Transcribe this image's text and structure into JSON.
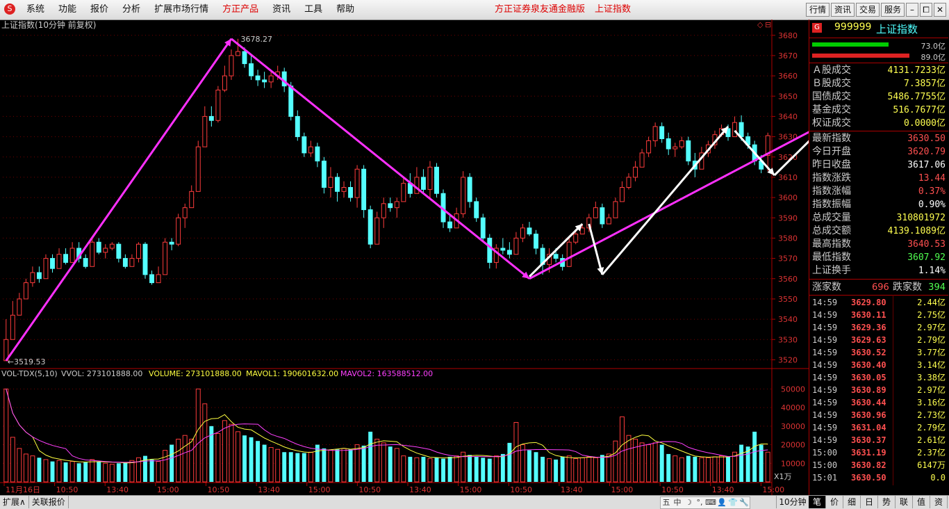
{
  "menu": {
    "logo": "S",
    "items": [
      "系统",
      "功能",
      "报价",
      "分析",
      "扩展市场行情",
      "方正产品",
      "资讯",
      "工具",
      "帮助"
    ],
    "highlight_index": 5,
    "center_links": [
      "方正证券泉友通金融版",
      "上证指数"
    ],
    "right_buttons": [
      "行情",
      "资讯",
      "交易",
      "服务"
    ],
    "window_buttons": [
      "–",
      "⧠",
      "✕"
    ]
  },
  "chart_header": {
    "title": "上证指数(10分钟 前复权)",
    "high_label": "3678.27",
    "low_label": "3519.53",
    "corner_icons": [
      "◇",
      "⊟"
    ]
  },
  "vol_header": {
    "name": "VOL-TDX(5,10)",
    "vvol": "VVOL: 273101888.00",
    "volume": "VOLUME: 273101888.00",
    "mavol1": "MAVOL1: 190601632.00",
    "mavol2": "MAVOL2: 163588512.00"
  },
  "colors": {
    "up": "#ff3c3c",
    "down": "#54ffff",
    "axis": "#b00000",
    "trend": "#ff30ff",
    "arrow": "#ffffff",
    "ma1": "#ffff40",
    "ma2": "#ff40ff"
  },
  "chart_data": {
    "type": "candlestick",
    "price_axis": {
      "ticks": [
        3520,
        3530,
        3540,
        3550,
        3560,
        3570,
        3580,
        3590,
        3600,
        3610,
        3620,
        3630,
        3640,
        3650,
        3660,
        3670,
        3680
      ],
      "range": [
        3515,
        3683
      ]
    },
    "volume_axis": {
      "ticks": [
        10000,
        20000,
        30000,
        40000,
        50000
      ],
      "unit_label": "X1万",
      "range": [
        0,
        55000
      ]
    },
    "x_labels": [
      "11月16日",
      "10:50",
      "13:40",
      "15:00",
      "10:50",
      "13:40",
      "15:00",
      "10:50",
      "13:40",
      "15:00",
      "10:50",
      "13:40",
      "15:00",
      "10:50",
      "13:40",
      "15:00"
    ],
    "period_label": "10分钟",
    "candles": [
      [
        3519.53,
        3519.5,
        3540,
        3530
      ],
      [
        3530,
        3530,
        3549,
        3542
      ],
      [
        3542,
        3542,
        3553,
        3550
      ],
      [
        3550,
        3550,
        3560,
        3558
      ],
      [
        3558,
        3556,
        3566,
        3563
      ],
      [
        3563,
        3558,
        3566,
        3560
      ],
      [
        3560,
        3560,
        3572,
        3570
      ],
      [
        3570,
        3563,
        3572,
        3565
      ],
      [
        3565,
        3565,
        3575,
        3572
      ],
      [
        3572,
        3567,
        3575,
        3568
      ],
      [
        3568,
        3568,
        3578,
        3575
      ],
      [
        3575,
        3568,
        3578,
        3570
      ],
      [
        3570,
        3565,
        3572,
        3566
      ],
      [
        3566,
        3566,
        3580,
        3578
      ],
      [
        3578,
        3572,
        3580,
        3573
      ],
      [
        3573,
        3570,
        3577,
        3575
      ],
      [
        3575,
        3574,
        3578,
        3577
      ],
      [
        3577,
        3568,
        3578,
        3570
      ],
      [
        3570,
        3565,
        3572,
        3566
      ],
      [
        3566,
        3566,
        3572,
        3570
      ],
      [
        3570,
        3568,
        3578,
        3577
      ],
      [
        3577,
        3560,
        3578,
        3562
      ],
      [
        3562,
        3557,
        3564,
        3558
      ],
      [
        3558,
        3558,
        3566,
        3562
      ],
      [
        3562,
        3562,
        3580,
        3578
      ],
      [
        3578,
        3574,
        3580,
        3577
      ],
      [
        3577,
        3576,
        3592,
        3590
      ],
      [
        3590,
        3585,
        3597,
        3595
      ],
      [
        3595,
        3595,
        3606,
        3603
      ],
      [
        3603,
        3603,
        3628,
        3625
      ],
      [
        3625,
        3625,
        3645,
        3640
      ],
      [
        3640,
        3635,
        3645,
        3638
      ],
      [
        3638,
        3637,
        3655,
        3653
      ],
      [
        3653,
        3652,
        3665,
        3660
      ],
      [
        3660,
        3658,
        3673,
        3670
      ],
      [
        3670,
        3670,
        3678.27,
        3672
      ],
      [
        3672,
        3664,
        3674,
        3666
      ],
      [
        3666,
        3658,
        3670,
        3660
      ],
      [
        3660,
        3655,
        3663,
        3658
      ],
      [
        3658,
        3654,
        3662,
        3657
      ],
      [
        3657,
        3654,
        3663,
        3660
      ],
      [
        3660,
        3658,
        3665,
        3662
      ],
      [
        3662,
        3652,
        3664,
        3655
      ],
      [
        3655,
        3638,
        3657,
        3640
      ],
      [
        3640,
        3628,
        3643,
        3630
      ],
      [
        3630,
        3620,
        3632,
        3622
      ],
      [
        3622,
        3620,
        3628,
        3625
      ],
      [
        3625,
        3615,
        3627,
        3618
      ],
      [
        3618,
        3602,
        3620,
        3605
      ],
      [
        3605,
        3600,
        3615,
        3610
      ],
      [
        3610,
        3598,
        3612,
        3603
      ],
      [
        3603,
        3600,
        3608,
        3605
      ],
      [
        3605,
        3598,
        3608,
        3600
      ],
      [
        3600,
        3595,
        3616,
        3614
      ],
      [
        3614,
        3590,
        3616,
        3594
      ],
      [
        3594,
        3575,
        3596,
        3577
      ],
      [
        3577,
        3577,
        3593,
        3590
      ],
      [
        3590,
        3585,
        3600,
        3597
      ],
      [
        3597,
        3593,
        3600,
        3595
      ],
      [
        3595,
        3590,
        3600,
        3598
      ],
      [
        3598,
        3598,
        3610,
        3607
      ],
      [
        3607,
        3600,
        3612,
        3602
      ],
      [
        3602,
        3602,
        3615,
        3610
      ],
      [
        3610,
        3602,
        3614,
        3604
      ],
      [
        3604,
        3600,
        3618,
        3615
      ],
      [
        3615,
        3600,
        3617,
        3602
      ],
      [
        3602,
        3585,
        3604,
        3588
      ],
      [
        3588,
        3583,
        3592,
        3585
      ],
      [
        3585,
        3585,
        3595,
        3592
      ],
      [
        3592,
        3590,
        3613,
        3610
      ],
      [
        3610,
        3595,
        3612,
        3598
      ],
      [
        3598,
        3588,
        3600,
        3590
      ],
      [
        3590,
        3578,
        3592,
        3580
      ],
      [
        3580,
        3565,
        3582,
        3568
      ],
      [
        3568,
        3565,
        3577,
        3575
      ],
      [
        3575,
        3572,
        3580,
        3574
      ],
      [
        3574,
        3570,
        3578,
        3572
      ],
      [
        3572,
        3572,
        3583,
        3580
      ],
      [
        3580,
        3578,
        3587,
        3585
      ],
      [
        3585,
        3581,
        3588,
        3582
      ],
      [
        3582,
        3572,
        3584,
        3575
      ],
      [
        3575,
        3562,
        3577,
        3567
      ],
      [
        3567,
        3563,
        3575,
        3572
      ],
      [
        3572,
        3568,
        3575,
        3570
      ],
      [
        3570,
        3564,
        3572,
        3566
      ],
      [
        3566,
        3566,
        3580,
        3578
      ],
      [
        3578,
        3577,
        3584,
        3582
      ],
      [
        3582,
        3582,
        3587,
        3585
      ],
      [
        3585,
        3583,
        3592,
        3590
      ],
      [
        3590,
        3590,
        3598,
        3595
      ],
      [
        3595,
        3585,
        3597,
        3587
      ],
      [
        3587,
        3587,
        3592,
        3590
      ],
      [
        3590,
        3590,
        3600,
        3598
      ],
      [
        3598,
        3598,
        3608,
        3605
      ],
      [
        3605,
        3604,
        3612,
        3610
      ],
      [
        3610,
        3608,
        3618,
        3615
      ],
      [
        3615,
        3615,
        3624,
        3622
      ],
      [
        3622,
        3620,
        3630,
        3628
      ],
      [
        3628,
        3625,
        3637,
        3635
      ],
      [
        3635,
        3627,
        3637,
        3629
      ],
      [
        3629,
        3621,
        3632,
        3624
      ],
      [
        3624,
        3620,
        3627,
        3625
      ],
      [
        3625,
        3624,
        3630,
        3628
      ],
      [
        3628,
        3616,
        3630,
        3618
      ],
      [
        3618,
        3610,
        3622,
        3614
      ],
      [
        3614,
        3614,
        3625,
        3622
      ],
      [
        3622,
        3620,
        3628,
        3626
      ],
      [
        3626,
        3624,
        3633,
        3631
      ],
      [
        3631,
        3630,
        3636,
        3634
      ],
      [
        3634,
        3628,
        3636,
        3630
      ],
      [
        3630,
        3630,
        3640,
        3637
      ],
      [
        3637,
        3628,
        3640.53,
        3630
      ],
      [
        3630,
        3624,
        3632,
        3626
      ],
      [
        3626,
        3616,
        3628,
        3618
      ],
      [
        3618,
        3612,
        3621,
        3614
      ],
      [
        3620.79,
        3613,
        3632,
        3630.5
      ]
    ],
    "volumes": [
      50000,
      24000,
      18000,
      15000,
      14000,
      13000,
      12000,
      11000,
      11500,
      10500,
      11000,
      10000,
      10500,
      12000,
      11000,
      10000,
      9500,
      10000,
      10500,
      11500,
      13000,
      14000,
      12000,
      11000,
      17000,
      20000,
      23000,
      25000,
      23000,
      50000,
      42000,
      30000,
      26000,
      33000,
      31000,
      27000,
      25000,
      24000,
      22000,
      20000,
      18500,
      17500,
      16000,
      16000,
      15500,
      15500,
      16000,
      20000,
      18000,
      17000,
      17500,
      18000,
      17500,
      20000,
      19500,
      27000,
      23000,
      21000,
      19000,
      18000,
      14000,
      13500,
      13000,
      13500,
      12500,
      13000,
      12500,
      13500,
      14000,
      16000,
      14500,
      13500,
      13000,
      12500,
      14000,
      15000,
      21000,
      32000,
      20000,
      17000,
      16000,
      13500,
      12500,
      12000,
      13500,
      14000,
      12500,
      13000,
      13500,
      13000,
      14500,
      15000,
      22000,
      35000,
      25000,
      23000,
      21000,
      20000,
      21000,
      20000,
      15000,
      14000,
      13000,
      14000,
      13500,
      13000,
      13000,
      13500,
      14000,
      13500,
      16000,
      20000,
      19000,
      27000,
      20000,
      16000
    ],
    "trendlines": [
      [
        [
          0,
          3519.53
        ],
        [
          34,
          3678.27
        ]
      ],
      [
        [
          34,
          3678.27
        ],
        [
          79,
          3560
        ]
      ],
      [
        [
          79,
          3560
        ],
        [
          126,
          3640.53
        ]
      ]
    ],
    "arrows": [
      [
        [
          79,
          3561
        ],
        [
          87,
          3587
        ]
      ],
      [
        [
          88,
          3587
        ],
        [
          90,
          3562
        ]
      ],
      [
        [
          90,
          3562
        ],
        [
          109,
          3635
        ]
      ],
      [
        [
          110,
          3633
        ],
        [
          116,
          3611
        ]
      ],
      [
        [
          116,
          3611
        ],
        [
          125,
          3640
        ]
      ]
    ]
  },
  "quote_panel": {
    "code_badge": "G",
    "code": "999999",
    "name": "上证指数",
    "bar_values": [
      "73.0亿",
      "89.0亿"
    ],
    "bar_fill": [
      0.55,
      0.7
    ],
    "rows": [
      {
        "label": "Ａ股成交",
        "value": "4131.7233亿",
        "color": "yel"
      },
      {
        "label": "Ｂ股成交",
        "value": "7.3857亿",
        "color": "yel"
      },
      {
        "label": "国债成交",
        "value": "5486.7755亿",
        "color": "yel"
      },
      {
        "label": "基金成交",
        "value": "516.7677亿",
        "color": "yel"
      },
      {
        "label": "权证成交",
        "value": "0.0000亿",
        "color": "yel"
      }
    ],
    "rows2": [
      {
        "label": "最新指数",
        "value": "3630.50",
        "color": "red"
      },
      {
        "label": "今日开盘",
        "value": "3620.79",
        "color": "red"
      },
      {
        "label": "昨日收盘",
        "value": "3617.06",
        "color": "wht"
      },
      {
        "label": "指数涨跌",
        "value": "13.44",
        "color": "red"
      },
      {
        "label": "指数涨幅",
        "value": "0.37%",
        "color": "red"
      },
      {
        "label": "指数振幅",
        "value": "0.90%",
        "color": "wht"
      },
      {
        "label": "总成交量",
        "value": "310801972",
        "color": "yel"
      },
      {
        "label": "总成交额",
        "value": "4139.1089亿",
        "color": "yel"
      },
      {
        "label": "最高指数",
        "value": "3640.53",
        "color": "red"
      },
      {
        "label": "最低指数",
        "value": "3607.92",
        "color": "grn"
      },
      {
        "label": "上证换手",
        "value": "1.14%",
        "color": "wht"
      }
    ],
    "updown": {
      "up_label": "涨家数",
      "up": "696",
      "down_label": "跌家数",
      "down": "394"
    },
    "ticks": [
      {
        "t": "14:59",
        "p": "3629.80",
        "a": "2.44亿"
      },
      {
        "t": "14:59",
        "p": "3630.11",
        "a": "2.75亿"
      },
      {
        "t": "14:59",
        "p": "3629.36",
        "a": "2.97亿"
      },
      {
        "t": "14:59",
        "p": "3629.63",
        "a": "2.79亿"
      },
      {
        "t": "14:59",
        "p": "3630.52",
        "a": "3.77亿"
      },
      {
        "t": "14:59",
        "p": "3630.40",
        "a": "3.14亿"
      },
      {
        "t": "14:59",
        "p": "3630.05",
        "a": "3.38亿"
      },
      {
        "t": "14:59",
        "p": "3630.89",
        "a": "2.97亿"
      },
      {
        "t": "14:59",
        "p": "3630.44",
        "a": "3.16亿"
      },
      {
        "t": "14:59",
        "p": "3630.96",
        "a": "2.73亿"
      },
      {
        "t": "14:59",
        "p": "3631.04",
        "a": "2.79亿"
      },
      {
        "t": "14:59",
        "p": "3630.37",
        "a": "2.61亿"
      },
      {
        "t": "15:00",
        "p": "3631.19",
        "a": "2.37亿"
      },
      {
        "t": "15:00",
        "p": "3630.82",
        "a": "6147万"
      },
      {
        "t": "15:01",
        "p": "3630.50",
        "a": "0.0"
      }
    ]
  },
  "bottombar": {
    "left": [
      "扩展∧",
      "关联报价"
    ],
    "ime": [
      "五",
      "中",
      "☽",
      "°,",
      "⌨",
      "👤",
      "👕",
      "🔧"
    ],
    "tabs": [
      "笔",
      "价",
      "细",
      "日",
      "势",
      "联",
      "值",
      "资"
    ],
    "active_tab": 0
  }
}
